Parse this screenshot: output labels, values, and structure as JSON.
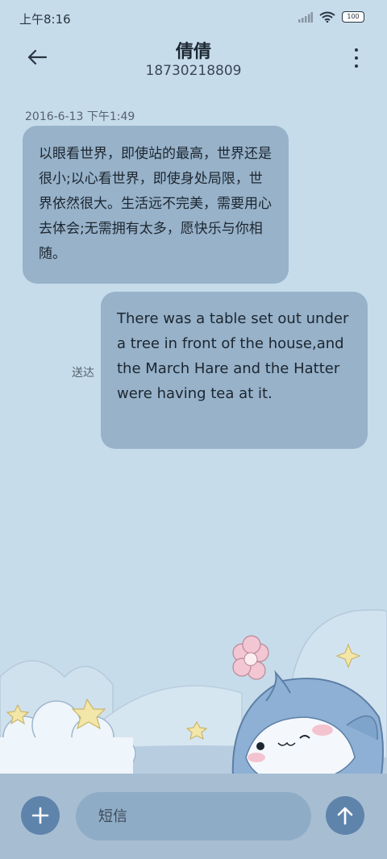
{
  "status_bar": {
    "time": "上午8:16",
    "battery": "100"
  },
  "header": {
    "contact_name": "倩倩",
    "phone_number": "18730218809"
  },
  "conversation": {
    "timestamp": "2016-6-13 下午1:49",
    "messages": [
      {
        "direction": "incoming",
        "text": "以眼看世界，即使站的最高，世界还是很小;以心看世界，即使身处局限，世界依然很大。生活远不完美，需要用心去体会;无需拥有太多，愿快乐与你相随。"
      },
      {
        "direction": "outgoing",
        "status": "送达",
        "text": "There was a table set out under a tree in front of the house,and the March Hare and the Hatter were having tea at it."
      }
    ]
  },
  "composer": {
    "placeholder": "短信"
  },
  "colors": {
    "background": "#c6dceb",
    "bubble": "#97b2c9",
    "accent_button": "#5f84ab",
    "input_bar": "#a7bdd2"
  },
  "icons": {
    "back": "arrow-left-icon",
    "more": "more-vertical-icon",
    "add": "plus-icon",
    "send": "arrow-up-icon"
  }
}
